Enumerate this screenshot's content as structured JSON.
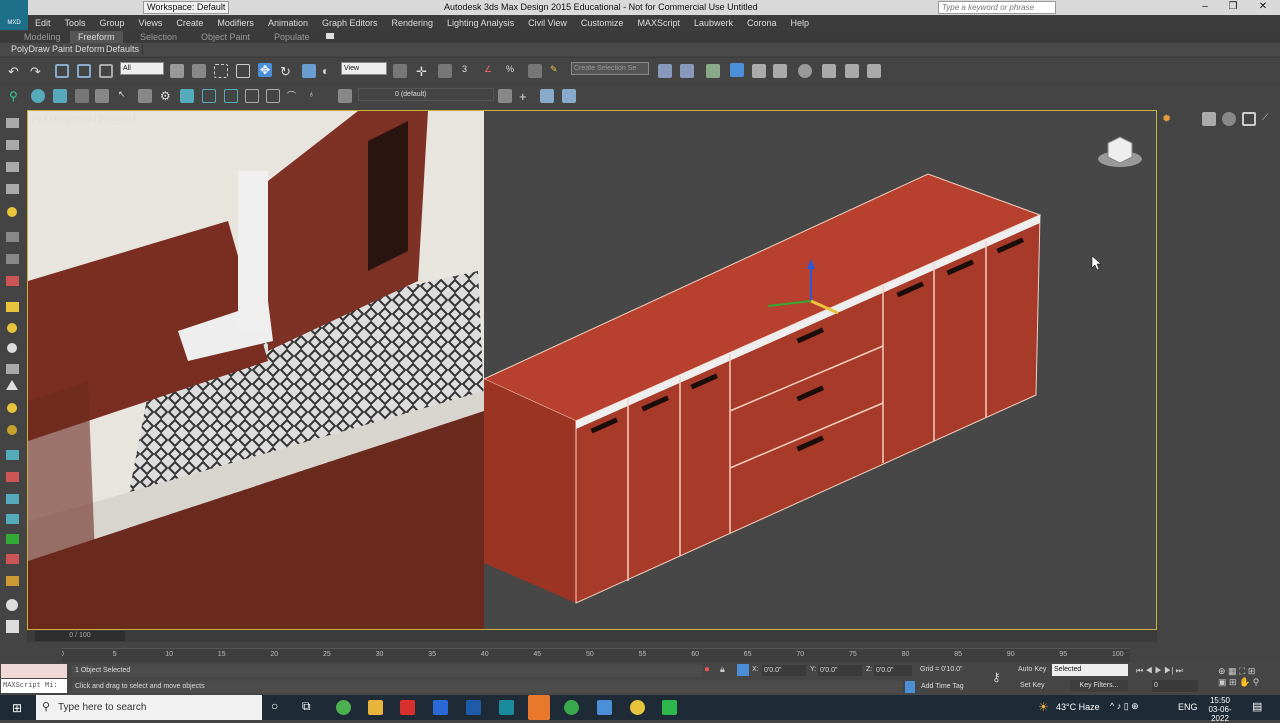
{
  "title": {
    "workspace": "Workspace: Default",
    "app_title": "Autodesk 3ds Max Design 2015  Educational - Not for Commercial Use   Untitled",
    "search_placeholder": "Type a keyword or phrase",
    "logo": "MXD"
  },
  "menu": [
    "Edit",
    "Tools",
    "Group",
    "Views",
    "Create",
    "Modifiers",
    "Animation",
    "Graph Editors",
    "Rendering",
    "Lighting Analysis",
    "Civil View",
    "Customize",
    "MAXScript",
    "Laubwerk",
    "Corona",
    "Help"
  ],
  "ribbon_tabs": [
    "Modeling",
    "Freeform",
    "Selection",
    "Object Paint",
    "Populate"
  ],
  "ribbon_active": "Freeform",
  "ribbon_sub": [
    "PolyDraw",
    "Paint Deform",
    "Defaults"
  ],
  "toolbar": {
    "filter": "All",
    "ref_coord": "View",
    "selection_set": "Create Selection Se",
    "layer": "0 (default)"
  },
  "viewport": {
    "label": "[+] [Orthographic ] [Realistic ]"
  },
  "timeline": {
    "frame": "0 / 100",
    "ticks": [
      "0",
      "5",
      "10",
      "15",
      "20",
      "25",
      "30",
      "35",
      "40",
      "45",
      "50",
      "55",
      "60",
      "65",
      "70",
      "75",
      "80",
      "85",
      "90",
      "95",
      "100"
    ]
  },
  "status": {
    "maxscript": "MAXScript Mi:",
    "selected": "1 Object Selected",
    "prompt": "Click and drag to select and move objects",
    "x_label": "X:",
    "x": "0'0.0\"",
    "y_label": "Y:",
    "y": "0'0.0\"",
    "z_label": "Z:",
    "z": "0'0.0\"",
    "grid": "Grid = 0'10.0\"",
    "add_time_tag": "Add Time Tag",
    "auto_key": "Auto Key",
    "set_key": "Set Key",
    "key_mode": "Selected",
    "key_filters": "Key Filters...",
    "frame_value": "0"
  },
  "taskbar": {
    "search": "Type here to search",
    "weather": "43°C  Haze",
    "lang": "ENG",
    "time": "15:50",
    "date": "03-06-2022"
  },
  "colors": {
    "cabinet": "#b53a2a",
    "viewport_border": "#c8b23c",
    "taskbar": "#1e2a36"
  }
}
